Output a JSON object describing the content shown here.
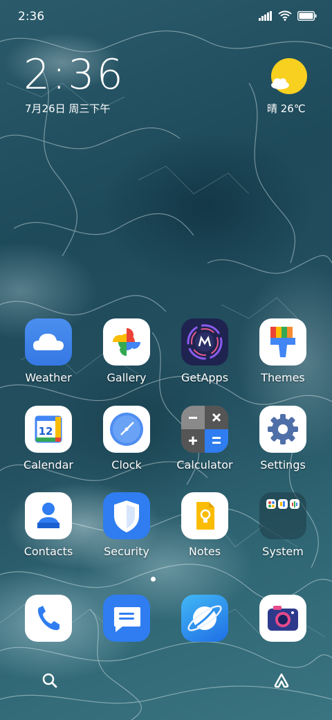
{
  "status_bar": {
    "time": "2:36"
  },
  "lockclock": {
    "time": "2:36",
    "date": "7月26日 周三下午"
  },
  "weather": {
    "text": "晴 26℃"
  },
  "apps": [
    {
      "label": "Weather",
      "icon": "weather-cloud-icon"
    },
    {
      "label": "Gallery",
      "icon": "google-photos-pinwheel-icon"
    },
    {
      "label": "GetApps",
      "icon": "motorola-logo-icon"
    },
    {
      "label": "Themes",
      "icon": "paint-brush-icon"
    },
    {
      "label": "Calendar",
      "icon": "calendar-12-icon"
    },
    {
      "label": "Clock",
      "icon": "clock-icon"
    },
    {
      "label": "Calculator",
      "icon": "calculator-icon"
    },
    {
      "label": "Settings",
      "icon": "gear-icon"
    },
    {
      "label": "Contacts",
      "icon": "person-icon"
    },
    {
      "label": "Security",
      "icon": "shield-icon"
    },
    {
      "label": "Notes",
      "icon": "note-bulb-icon"
    },
    {
      "label": "System",
      "icon": "folder-icon"
    }
  ],
  "calendar_day": "12",
  "dock": [
    {
      "name": "phone",
      "icon": "phone-icon"
    },
    {
      "name": "messages",
      "icon": "message-icon"
    },
    {
      "name": "browser",
      "icon": "planet-icon"
    },
    {
      "name": "camera",
      "icon": "camera-icon"
    }
  ]
}
